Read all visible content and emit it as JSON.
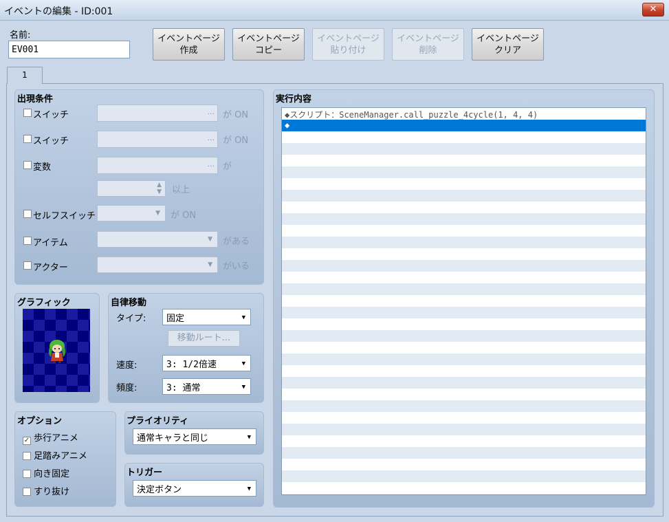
{
  "window": {
    "title": "イベントの編集 - ID:001",
    "close_glyph": "✕"
  },
  "name": {
    "label": "名前:",
    "value": "EV001"
  },
  "page_buttons": [
    {
      "line1": "イベントページ",
      "line2": "作成",
      "enabled": true
    },
    {
      "line1": "イベントページ",
      "line2": "コピー",
      "enabled": true
    },
    {
      "line1": "イベントページ",
      "line2": "貼り付け",
      "enabled": false
    },
    {
      "line1": "イベントページ",
      "line2": "削除",
      "enabled": false
    },
    {
      "line1": "イベントページ",
      "line2": "クリア",
      "enabled": true
    }
  ],
  "tab": {
    "label": "1"
  },
  "conditions": {
    "title": "出現条件",
    "switch1": {
      "label": "スイッチ",
      "suffix": "が ON",
      "checked": false
    },
    "switch2": {
      "label": "スイッチ",
      "suffix": "が ON",
      "checked": false
    },
    "variable": {
      "label": "変数",
      "suffix": "が",
      "checked": false,
      "threshold_suffix": "以上"
    },
    "self_switch": {
      "label": "セルフスイッチ",
      "suffix": "が ON",
      "checked": false
    },
    "item": {
      "label": "アイテム",
      "suffix": "がある",
      "checked": false
    },
    "actor": {
      "label": "アクター",
      "suffix": "がいる",
      "checked": false
    }
  },
  "graphic": {
    "title": "グラフィック"
  },
  "movement": {
    "title": "自律移動",
    "type_label": "タイプ:",
    "type_value": "固定",
    "route_button": "移動ルート...",
    "speed_label": "速度:",
    "speed_value": "3: 1/2倍速",
    "freq_label": "頻度:",
    "freq_value": "3: 通常"
  },
  "options": {
    "title": "オプション",
    "items": [
      {
        "label": "歩行アニメ",
        "checked": true
      },
      {
        "label": "足踏みアニメ",
        "checked": false
      },
      {
        "label": "向き固定",
        "checked": false
      },
      {
        "label": "すり抜け",
        "checked": false
      }
    ]
  },
  "priority": {
    "title": "プライオリティ",
    "value": "通常キャラと同じ"
  },
  "trigger": {
    "title": "トリガー",
    "value": "決定ボタン"
  },
  "contents": {
    "title": "実行内容",
    "commands": [
      {
        "text": "◆スクリプト：SceneManager.call_puzzle_4cycle(1, 4, 4)"
      },
      {
        "text": "◆"
      }
    ],
    "selected_index": 1
  },
  "colors": {
    "selection": "#0078d7",
    "panel": "#c9d7e8",
    "sprite_bg": "#00007a"
  }
}
